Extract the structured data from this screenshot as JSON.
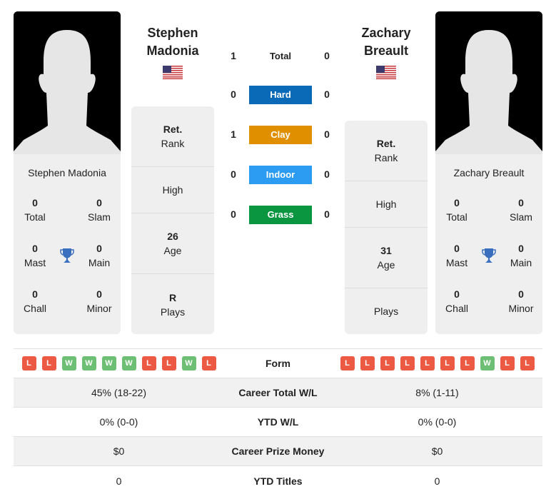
{
  "colors": {
    "hard": "#0b6ab8",
    "clay": "#e08f00",
    "indoor": "#2b9cf2",
    "grass": "#0a9640",
    "win": "#6cbf73",
    "loss": "#ec5a44",
    "trophy": "#3a6fbf"
  },
  "player1": {
    "name_line1": "Stephen",
    "name_line2": "Madonia",
    "full_name": "Stephen Madonia",
    "flag": "us-flag",
    "titles": {
      "total": "0",
      "total_label": "Total",
      "slam": "0",
      "slam_label": "Slam",
      "mast": "0",
      "mast_label": "Mast",
      "main": "0",
      "main_label": "Main",
      "chall": "0",
      "chall_label": "Chall",
      "minor": "0",
      "minor_label": "Minor"
    },
    "rank": {
      "value": "Ret.",
      "label": "Rank"
    },
    "high": {
      "value": "",
      "label": "High"
    },
    "age": {
      "value": "26",
      "label": "Age"
    },
    "plays": {
      "value": "R",
      "label": "Plays"
    },
    "form": [
      "L",
      "L",
      "W",
      "W",
      "W",
      "W",
      "L",
      "L",
      "W",
      "L"
    ]
  },
  "player2": {
    "name_line1": "Zachary",
    "name_line2": "Breault",
    "full_name": "Zachary Breault",
    "flag": "us-flag",
    "titles": {
      "total": "0",
      "total_label": "Total",
      "slam": "0",
      "slam_label": "Slam",
      "mast": "0",
      "mast_label": "Mast",
      "main": "0",
      "main_label": "Main",
      "chall": "0",
      "chall_label": "Chall",
      "minor": "0",
      "minor_label": "Minor"
    },
    "rank": {
      "value": "Ret.",
      "label": "Rank"
    },
    "high": {
      "value": "",
      "label": "High"
    },
    "age": {
      "value": "31",
      "label": "Age"
    },
    "plays": {
      "value": "",
      "label": "Plays"
    },
    "form": [
      "L",
      "L",
      "L",
      "L",
      "L",
      "L",
      "L",
      "W",
      "L",
      "L"
    ]
  },
  "h2h": [
    {
      "label": "Total",
      "p1": "1",
      "p2": "0",
      "type": "total"
    },
    {
      "label": "Hard",
      "p1": "0",
      "p2": "0",
      "type": "hard"
    },
    {
      "label": "Clay",
      "p1": "1",
      "p2": "0",
      "type": "clay"
    },
    {
      "label": "Indoor",
      "p1": "0",
      "p2": "0",
      "type": "indoor"
    },
    {
      "label": "Grass",
      "p1": "0",
      "p2": "0",
      "type": "grass"
    }
  ],
  "table": {
    "form_label": "Form",
    "rows": [
      {
        "label": "Career Total W/L",
        "p1": "45% (18-22)",
        "p2": "8% (1-11)"
      },
      {
        "label": "YTD W/L",
        "p1": "0% (0-0)",
        "p2": "0% (0-0)"
      },
      {
        "label": "Career Prize Money",
        "p1": "$0",
        "p2": "$0"
      },
      {
        "label": "YTD Titles",
        "p1": "0",
        "p2": "0"
      }
    ]
  }
}
